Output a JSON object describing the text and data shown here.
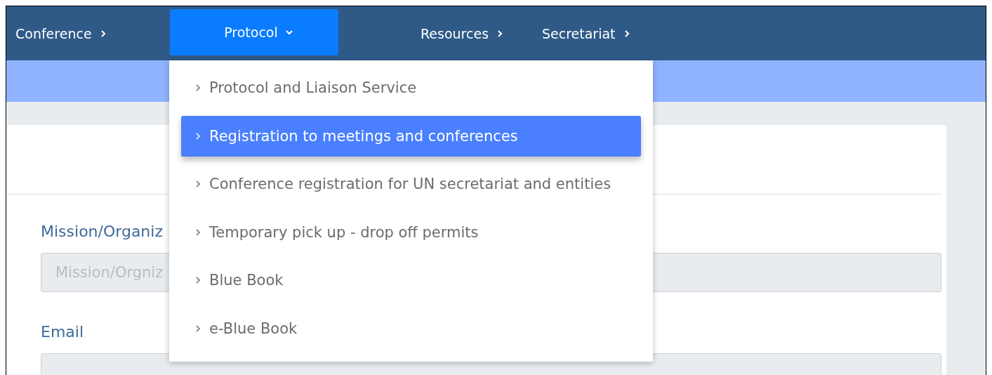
{
  "nav": {
    "items": [
      {
        "label": "Conference",
        "selected": false,
        "expanded": false
      },
      {
        "label": "Protocol",
        "selected": true,
        "expanded": true
      },
      {
        "label": "Resources",
        "selected": false,
        "expanded": false
      },
      {
        "label": "Secretariat",
        "selected": false,
        "expanded": false
      }
    ]
  },
  "dropdown": {
    "items": [
      {
        "label": "Protocol and Liaison Service",
        "selected": false
      },
      {
        "label": "Registration to meetings and conferences",
        "selected": true
      },
      {
        "label": "Conference registration for UN secretariat and entities",
        "selected": false
      },
      {
        "label": "Temporary pick up - drop off permits",
        "selected": false
      },
      {
        "label": "Blue Book",
        "selected": false
      },
      {
        "label": "e-Blue Book",
        "selected": false
      }
    ]
  },
  "form": {
    "fields": [
      {
        "label": "Mission/Organiz",
        "placeholder": "Mission/Orgniz"
      },
      {
        "label": "Email"
      }
    ]
  }
}
